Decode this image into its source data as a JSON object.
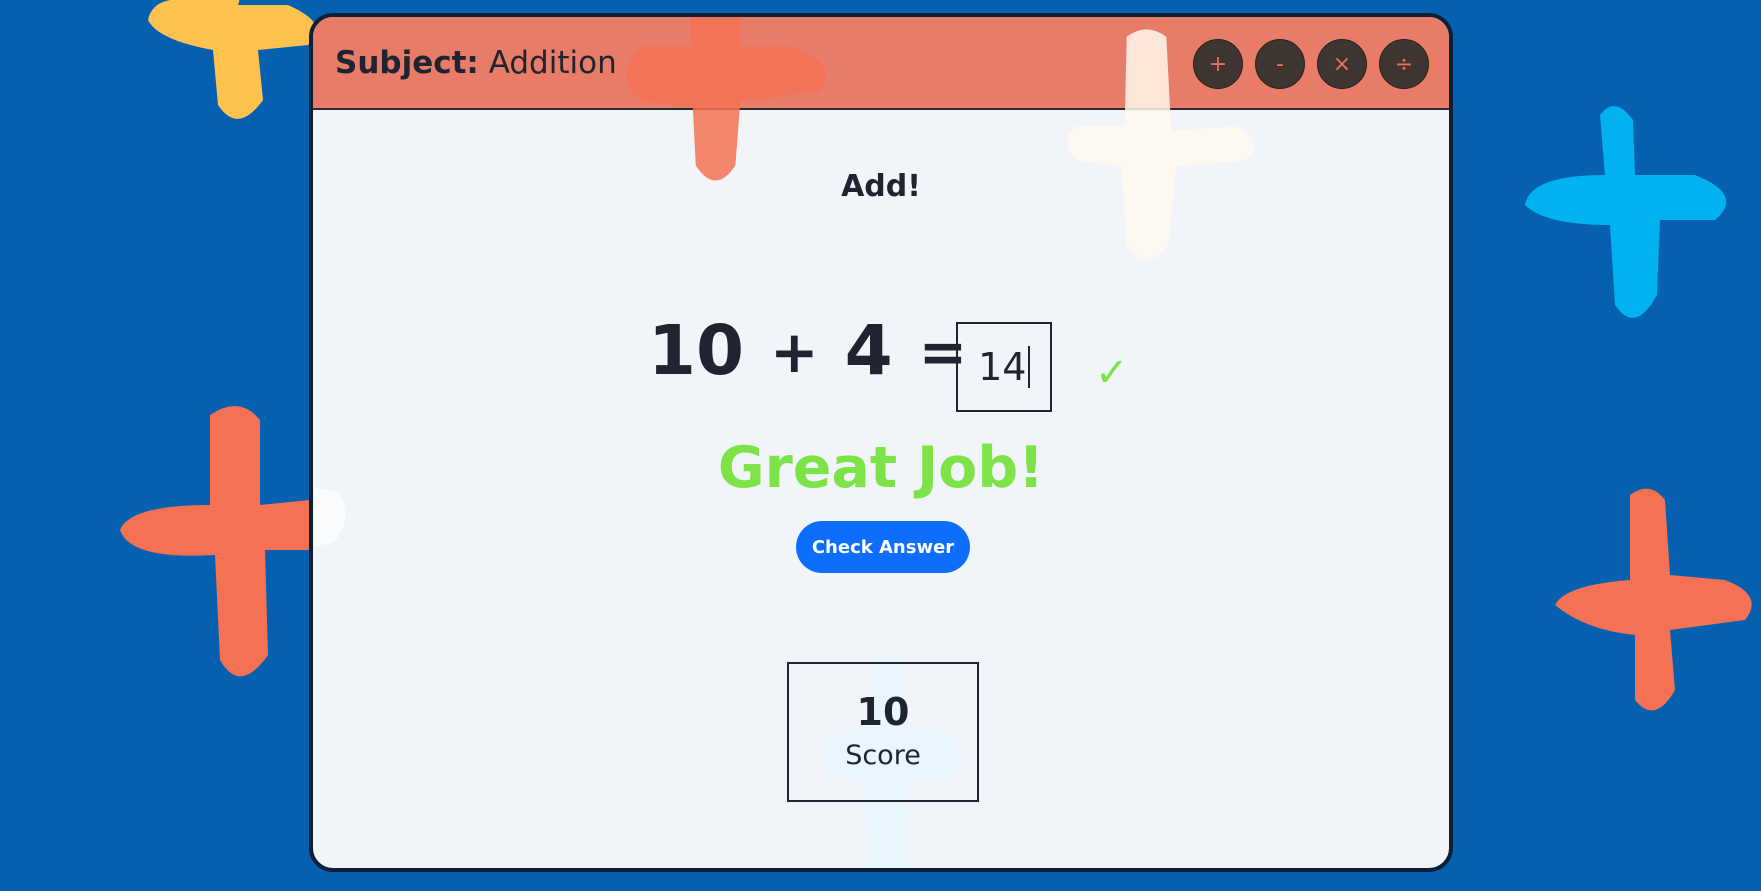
{
  "header": {
    "subject_label": "Subject:",
    "subject_value": "Addition"
  },
  "operations": [
    "+",
    "-",
    "×",
    "÷"
  ],
  "instruction": "Add!",
  "problem": {
    "operand_a": "10",
    "operator": "+",
    "operand_b": "4",
    "equals": "=",
    "answer_value": "14"
  },
  "status_icon": "✓",
  "feedback": "Great Job!",
  "check_button_label": "Check Answer",
  "score": {
    "value": "10",
    "label": "Score"
  },
  "colors": {
    "background": "#0660b0",
    "titlebar": "#e8725c",
    "accent_green": "#7ee348",
    "button_blue": "#0d6efd",
    "plus_orange": "#f47253",
    "plus_yellow": "#ffc24e",
    "plus_cyan": "#00b2f0",
    "plus_cream": "#fff9ef"
  }
}
